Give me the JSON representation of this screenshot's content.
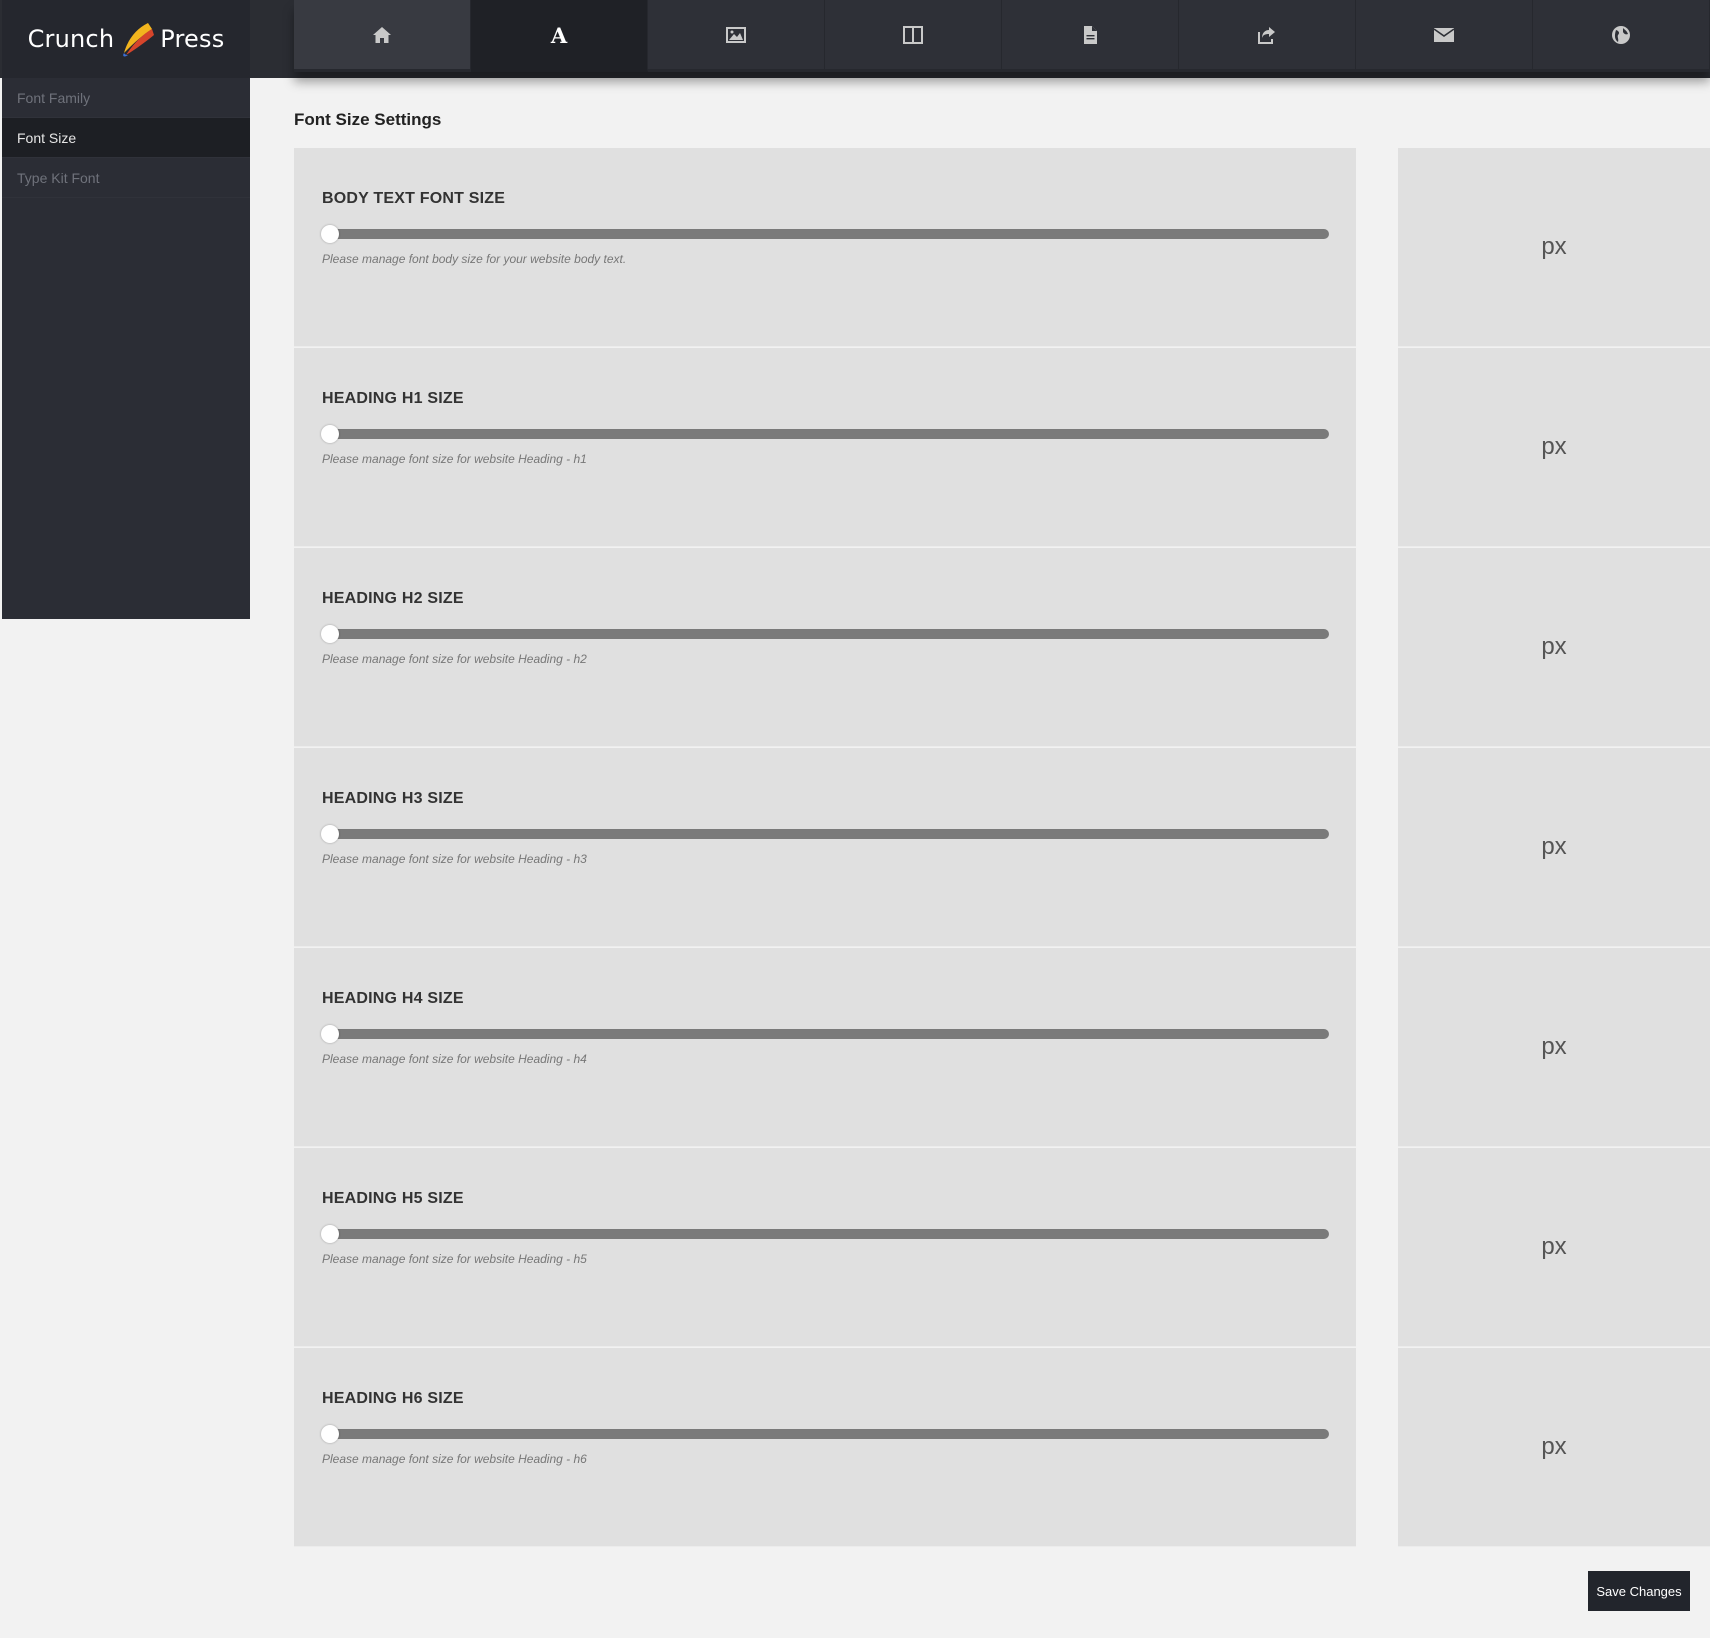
{
  "brand": {
    "name_left": "Crunch",
    "name_right": "Press",
    "accent_colors": [
      "#f2b51e",
      "#d6452b",
      "#3a6fd8"
    ]
  },
  "tabs": [
    {
      "icon": "home-icon",
      "active": false
    },
    {
      "icon": "typography-icon",
      "active": true
    },
    {
      "icon": "image-icon",
      "active": false
    },
    {
      "icon": "layout-icon",
      "active": false
    },
    {
      "icon": "document-icon",
      "active": false
    },
    {
      "icon": "share-icon",
      "active": false
    },
    {
      "icon": "envelope-icon",
      "active": false
    },
    {
      "icon": "globe-icon",
      "active": false
    }
  ],
  "sidebar": {
    "items": [
      {
        "label": "Font Family",
        "active": false
      },
      {
        "label": "Font Size",
        "active": true
      },
      {
        "label": "Type Kit Font",
        "active": false
      }
    ]
  },
  "content": {
    "title": "Font Size Settings",
    "unit": "px",
    "settings": [
      {
        "label": "BODY TEXT FONT SIZE",
        "description": "Please manage font body size for your website body text.",
        "value": "",
        "slider_fraction": 0
      },
      {
        "label": "HEADING H1 SIZE",
        "description": "Please manage font size for website Heading - h1",
        "value": "",
        "slider_fraction": 0
      },
      {
        "label": "HEADING H2 SIZE",
        "description": "Please manage font size for website Heading - h2",
        "value": "",
        "slider_fraction": 0
      },
      {
        "label": "HEADING H3 SIZE",
        "description": "Please manage font size for website Heading - h3",
        "value": "",
        "slider_fraction": 0
      },
      {
        "label": "HEADING H4 SIZE",
        "description": "Please manage font size for website Heading - h4",
        "value": "",
        "slider_fraction": 0
      },
      {
        "label": "HEADING H5 SIZE",
        "description": "Please manage font size for website Heading - h5",
        "value": "",
        "slider_fraction": 0
      },
      {
        "label": "HEADING H6 SIZE",
        "description": "Please manage font size for website Heading - h6",
        "value": "",
        "slider_fraction": 0
      }
    ]
  },
  "actions": {
    "save_label": "Save Changes"
  },
  "colors": {
    "topbar": "#2b2d33",
    "sidebar": "#2b2d35",
    "card": "#e0e0e0",
    "background": "#f2f2f2",
    "slider_track": "#7a7a7a"
  }
}
